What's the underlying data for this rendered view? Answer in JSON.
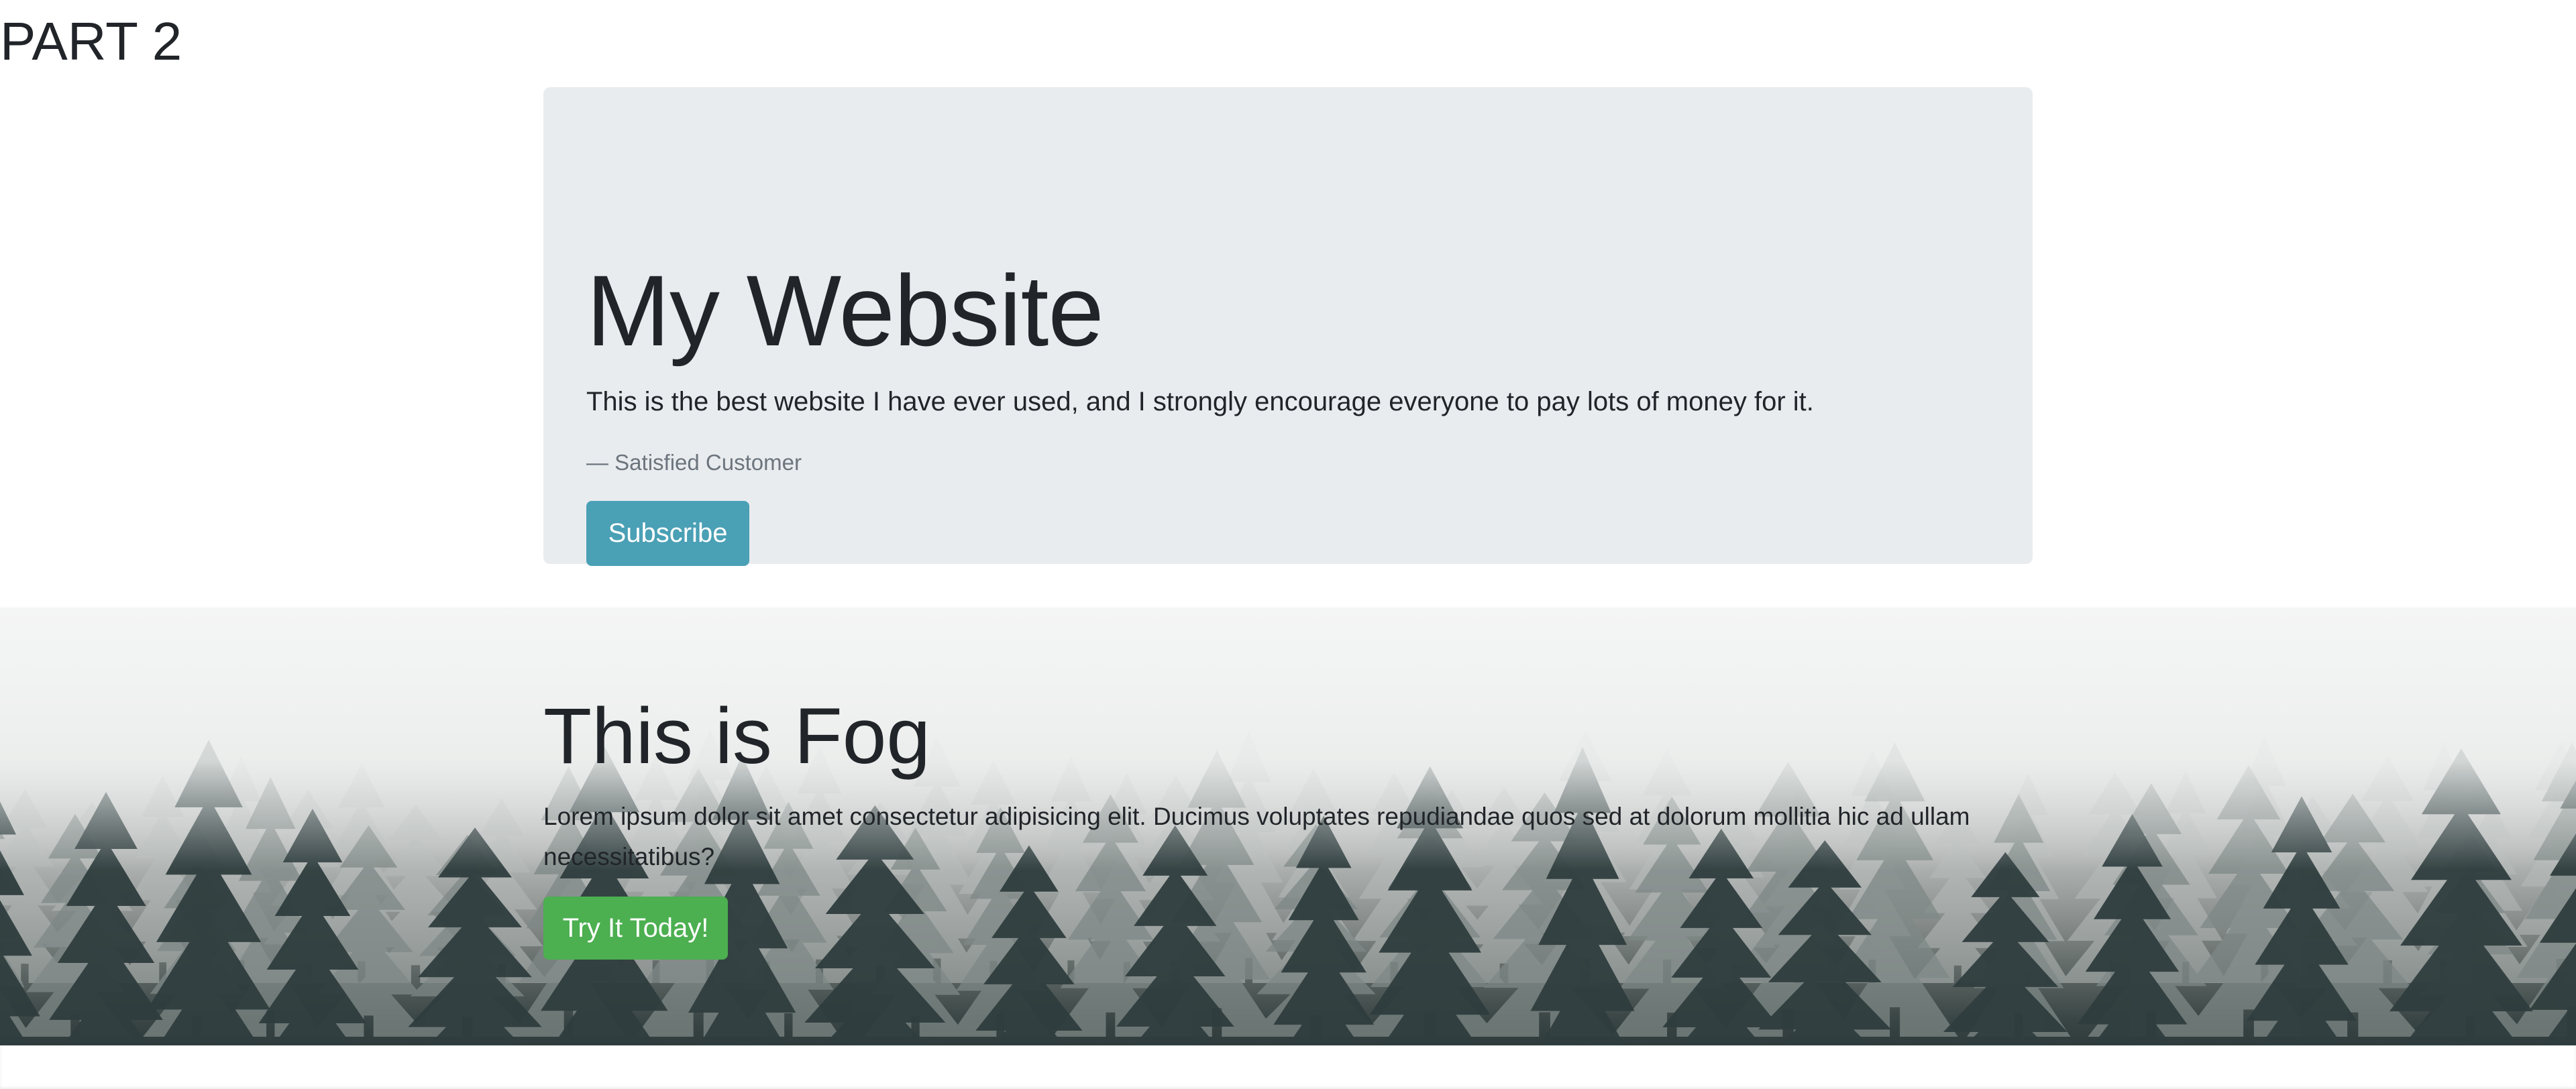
{
  "part_title": "PART 2",
  "jumbotron": {
    "heading": "My Website",
    "lead": "This is the best website I have ever used, and I strongly encourage everyone to pay lots of money for it.",
    "cite": "— Satisfied Customer",
    "button_label": "Subscribe"
  },
  "fog_section": {
    "heading": "This is Fog",
    "lead": "Lorem ipsum dolor sit amet consectetur adipisicing elit. Ducimus voluptates repudiandae quos sed at dolorum mollitia hic ad ullam necessitatibus?",
    "button_label": "Try It Today!"
  },
  "colors": {
    "jumbotron_bg": "#e9ecef",
    "info_button": "#4aa0b5",
    "success_button": "#4caf50",
    "text": "#212529",
    "muted": "#6c757d"
  }
}
